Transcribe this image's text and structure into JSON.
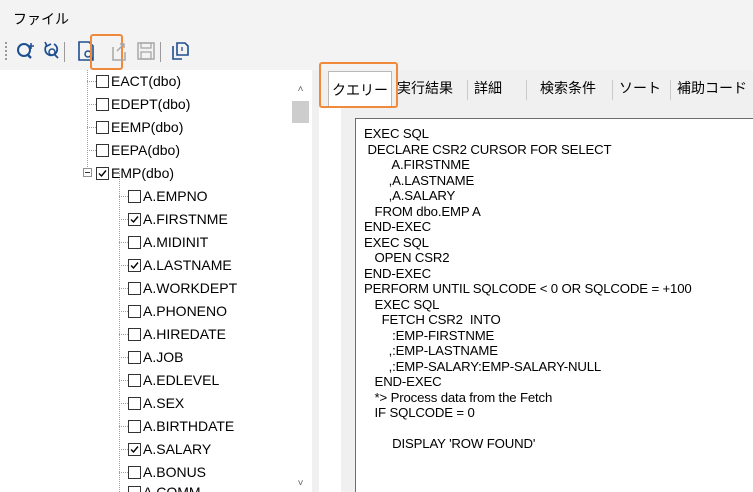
{
  "menubar": {
    "file": "ファイル"
  },
  "toolbar": {
    "buttons": [
      {
        "icon": "add-query-icon"
      },
      {
        "icon": "refresh-query-icon"
      },
      {
        "icon": "new-document-icon",
        "highlighted": true
      },
      {
        "icon": "export-icon"
      },
      {
        "icon": "save-icon"
      },
      {
        "icon": "copy-icon"
      }
    ],
    "highlight_color": "#f08a3a"
  },
  "tree": {
    "items": [
      {
        "label": "EACT(dbo)",
        "checked": false
      },
      {
        "label": "EDEPT(dbo)",
        "checked": false
      },
      {
        "label": "EEMP(dbo)",
        "checked": false
      },
      {
        "label": "EEPA(dbo)",
        "checked": false
      },
      {
        "label": "EMP(dbo)",
        "checked": true,
        "expanded": true
      },
      {
        "label": "A.EMPNO",
        "checked": false
      },
      {
        "label": "A.FIRSTNME",
        "checked": true
      },
      {
        "label": "A.MIDINIT",
        "checked": false
      },
      {
        "label": "A.LASTNAME",
        "checked": true
      },
      {
        "label": "A.WORKDEPT",
        "checked": false
      },
      {
        "label": "A.PHONENO",
        "checked": false
      },
      {
        "label": "A.HIREDATE",
        "checked": false
      },
      {
        "label": "A.JOB",
        "checked": false
      },
      {
        "label": "A.EDLEVEL",
        "checked": false
      },
      {
        "label": "A.SEX",
        "checked": false
      },
      {
        "label": "A.BIRTHDATE",
        "checked": false
      },
      {
        "label": "A.SALARY",
        "checked": true
      },
      {
        "label": "A.BONUS",
        "checked": false
      },
      {
        "label": "A.COMM",
        "checked": false
      }
    ]
  },
  "tabs": [
    {
      "label": "クエリー",
      "active": true
    },
    {
      "label": "実行結果",
      "active": false
    },
    {
      "label": "詳細",
      "active": false
    },
    {
      "label": "検索条件",
      "active": false
    },
    {
      "label": "ソート",
      "active": false
    },
    {
      "label": "補助コード",
      "active": false
    }
  ],
  "editor": {
    "code": "EXEC SQL\n DECLARE CSR2 CURSOR FOR SELECT\n        A.FIRSTNME\n       ,A.LASTNAME\n       ,A.SALARY\n   FROM dbo.EMP A\nEND-EXEC\nEXEC SQL\n   OPEN CSR2\nEND-EXEC\nPERFORM UNTIL SQLCODE < 0 OR SQLCODE = +100\n   EXEC SQL\n     FETCH CSR2  INTO\n        :EMP-FIRSTNME\n       ,:EMP-LASTNAME\n       ,:EMP-SALARY:EMP-SALARY-NULL\n   END-EXEC\n   *> Process data from the Fetch\n   IF SQLCODE = 0\n\n        DISPLAY 'ROW FOUND'"
  }
}
